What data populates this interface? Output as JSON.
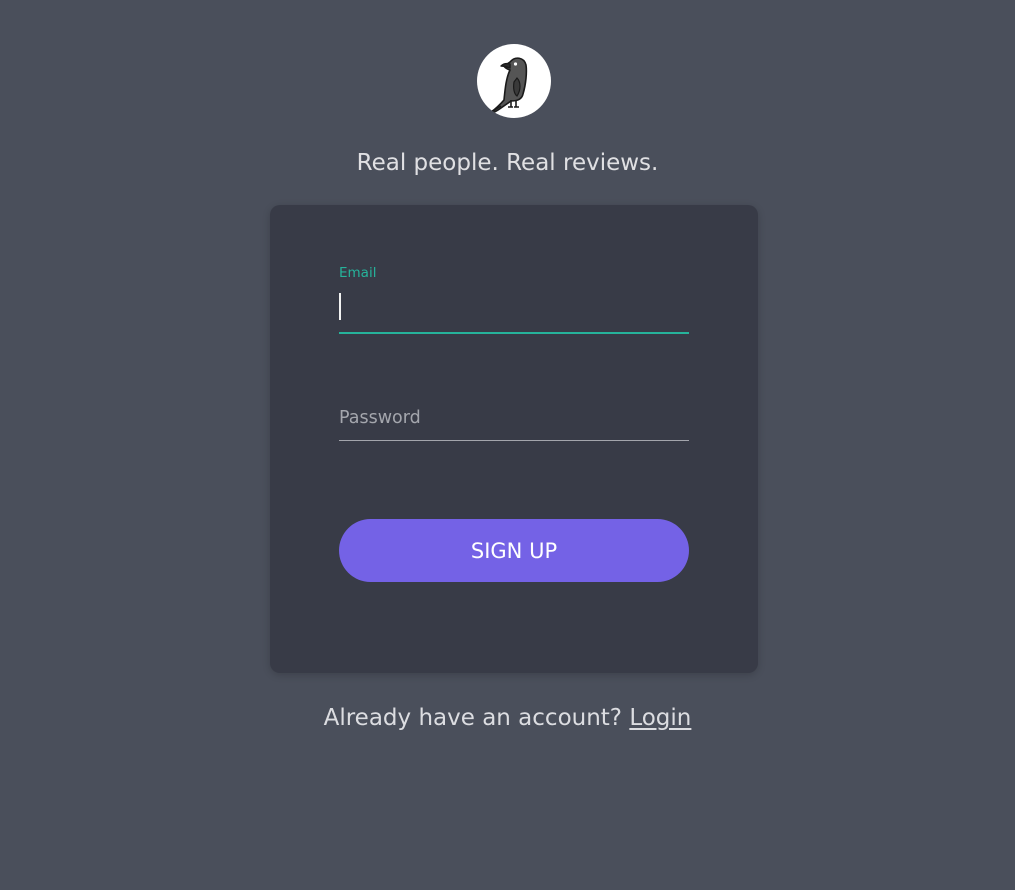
{
  "brand": {
    "logo_icon": "crow-icon",
    "tagline": "Real people. Real reviews."
  },
  "form": {
    "email": {
      "label": "Email",
      "value": ""
    },
    "password": {
      "placeholder": "Password",
      "value": ""
    },
    "submit_label": "SIGN UP"
  },
  "footer": {
    "prompt": "Already have an account?",
    "login_link": "Login"
  },
  "colors": {
    "background": "#4a4f5b",
    "card": "#383b47",
    "accent_teal": "#26b39b",
    "button_purple": "#7462e6"
  }
}
